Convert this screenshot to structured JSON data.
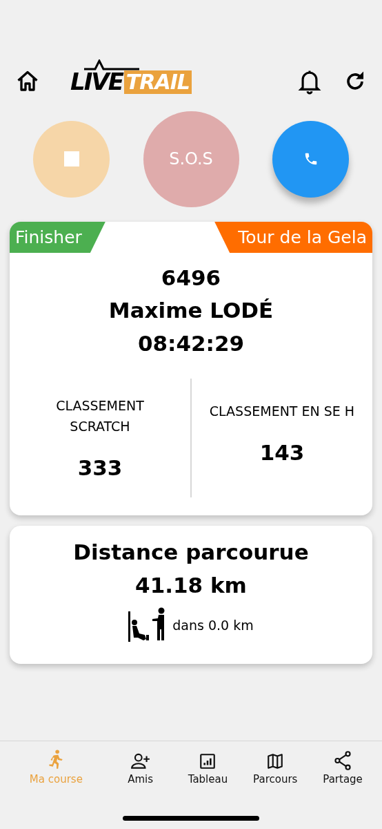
{
  "header": {
    "logo": {
      "part_1": "LIVE",
      "part_2": "TRAIL"
    }
  },
  "actions": [
    {
      "kind": "stop"
    },
    {
      "kind": "sos",
      "label": "S.O.S"
    },
    {
      "kind": "call"
    }
  ],
  "result_card": {
    "status_tag": "Finisher",
    "race_tag": "Tour de la Gela",
    "bib": "6496",
    "name": "Maxime LODÉ",
    "time": "08:42:29",
    "rankings": [
      {
        "label": "CLASSEMENT SCRATCH",
        "value": "333"
      },
      {
        "label": "CLASSEMENT EN SE H",
        "value": "143"
      }
    ]
  },
  "distance_card": {
    "title": "Distance parcourue",
    "distance": "41.18 km",
    "next_aid": "dans 0.0 km"
  },
  "bottom_nav": [
    {
      "kind": "runner",
      "label": "Ma course",
      "selected": true
    },
    {
      "kind": "add-person",
      "label": "Amis",
      "selected": false
    },
    {
      "kind": "chart",
      "label": "Tableau",
      "selected": false
    },
    {
      "kind": "map",
      "label": "Parcours",
      "selected": false
    },
    {
      "kind": "share",
      "label": "Partage",
      "selected": false
    }
  ]
}
